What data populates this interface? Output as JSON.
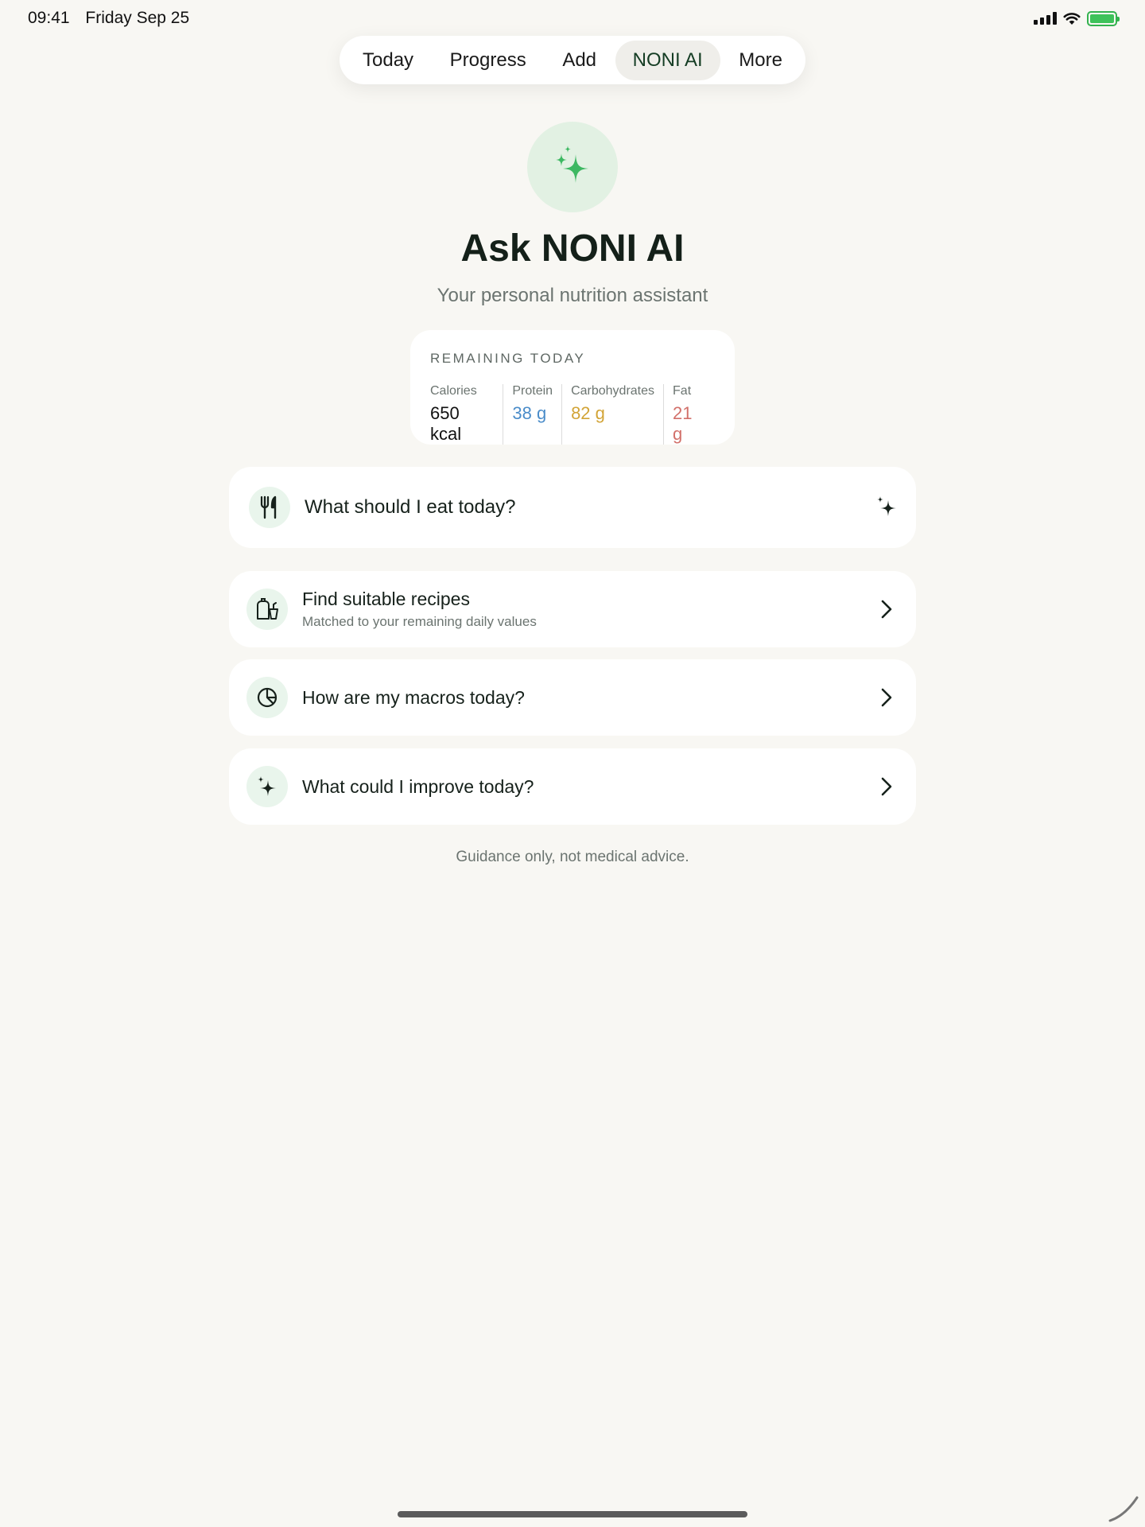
{
  "status_bar": {
    "time": "09:41",
    "date": "Friday Sep 25",
    "icons": [
      "signal-icon",
      "wifi-icon",
      "battery-charging-icon"
    ],
    "battery_color": "#3ec25a"
  },
  "tabs": [
    {
      "label": "Today",
      "active": false
    },
    {
      "label": "Progress",
      "active": false
    },
    {
      "label": "Add",
      "active": false
    },
    {
      "label": "NONI AI",
      "active": true
    },
    {
      "label": "More",
      "active": false
    }
  ],
  "hero": {
    "icon": "sparkles-icon",
    "title": "Ask NONI AI",
    "subtitle": "Your personal nutrition assistant"
  },
  "remaining": {
    "title": "REMAINING TODAY",
    "macros": [
      {
        "label": "Calories",
        "value": "650 kcal",
        "color": "#111111"
      },
      {
        "label": "Protein",
        "value": "38 g",
        "color": "#4a8cc9"
      },
      {
        "label": "Carbohydrates",
        "value": "82 g",
        "color": "#d2a437"
      },
      {
        "label": "Fat",
        "value": "21 g",
        "color": "#d2706a"
      }
    ]
  },
  "actions": [
    {
      "title": "What should I eat today?",
      "icon": "fork-knife-icon",
      "trailing": "sparkle-icon"
    },
    {
      "title": "Find suitable recipes",
      "subtitle": "Matched to your remaining daily values",
      "icon": "recipe-icon",
      "trailing": "chevron-right-icon"
    },
    {
      "title": "How are my macros today?",
      "icon": "pie-chart-icon",
      "trailing": "chevron-right-icon"
    },
    {
      "title": "What could I improve today?",
      "icon": "sparkle-icon",
      "trailing": "chevron-right-icon"
    }
  ],
  "disclaimer": "Guidance only, not medical advice.",
  "accent_color": "#3db862"
}
